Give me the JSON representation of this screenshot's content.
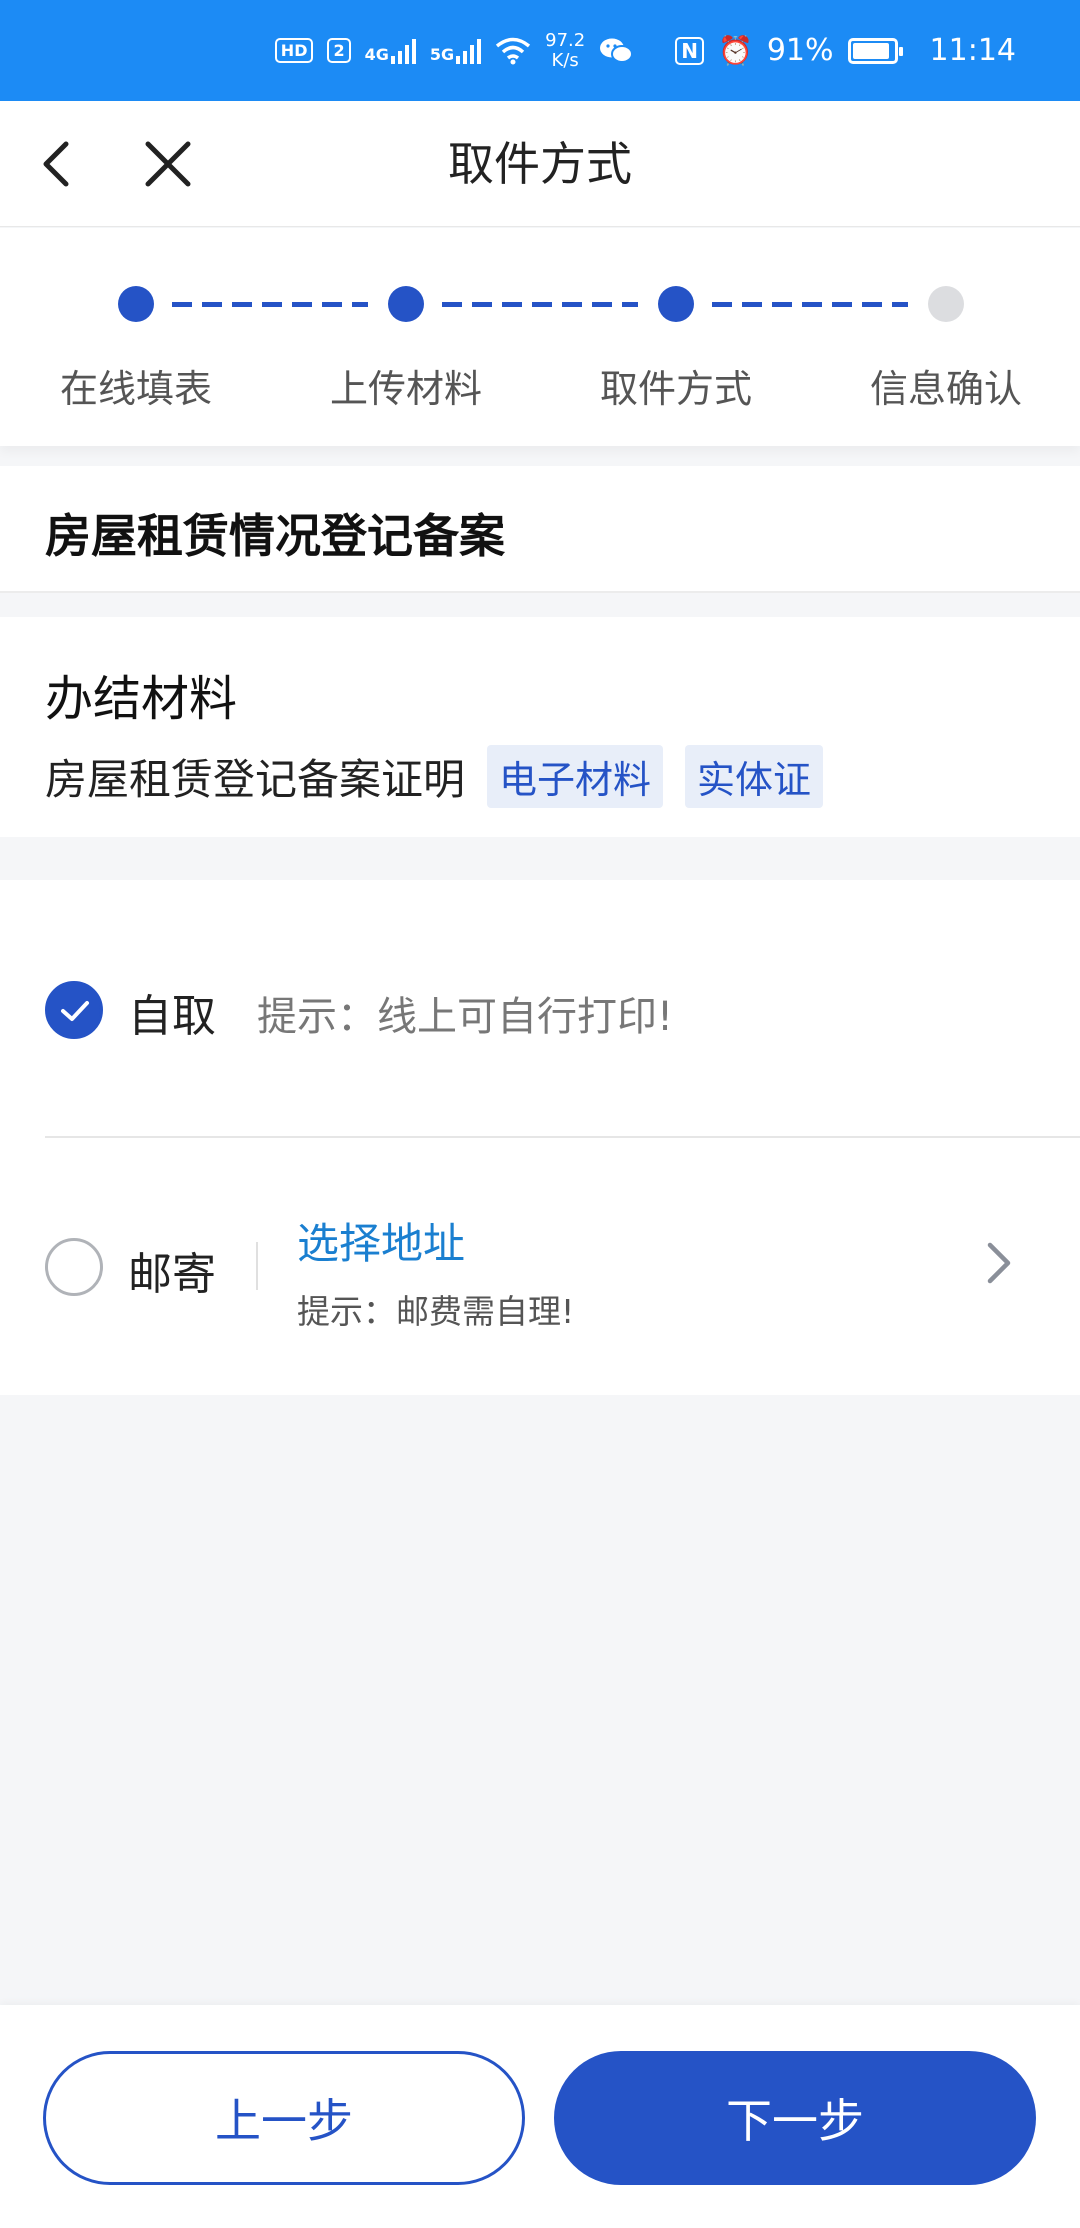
{
  "status_bar": {
    "badge_hd": "HD",
    "badge_sim": "2",
    "net1": "4G",
    "net2": "5G",
    "speed_value": "97.2",
    "speed_unit": "K/s",
    "nfc": "N",
    "alarm": "⏰",
    "battery_percent": "91%",
    "battery_level": 0.91,
    "time": "11:14"
  },
  "nav": {
    "title": "取件方式",
    "back_icon": "chevron-left-icon",
    "close_icon": "close-icon"
  },
  "stepper": {
    "steps": [
      {
        "label": "在线填表",
        "state": "done"
      },
      {
        "label": "上传材料",
        "state": "done"
      },
      {
        "label": "取件方式",
        "state": "current"
      },
      {
        "label": "信息确认",
        "state": "pending"
      }
    ]
  },
  "service": {
    "title": "房屋租赁情况登记备案"
  },
  "materials": {
    "heading": "办结材料",
    "item_name": "房屋租赁登记备案证明",
    "tags": [
      "电子材料",
      "实体证"
    ]
  },
  "options": {
    "self_pickup": {
      "label": "自取",
      "hint": "提示：线上可自行打印!",
      "checked": true
    },
    "mail": {
      "label": "邮寄",
      "address_link": "选择地址",
      "hint": "提示：邮费需自理!",
      "checked": false
    }
  },
  "footer": {
    "prev_label": "上一步",
    "next_label": "下一步"
  },
  "colors": {
    "status_bar_bg": "#1c8bf5",
    "primary": "#2553c6",
    "link": "#1a7fd0",
    "tag_bg": "#e8eef9",
    "page_bg": "#f5f6f8"
  }
}
